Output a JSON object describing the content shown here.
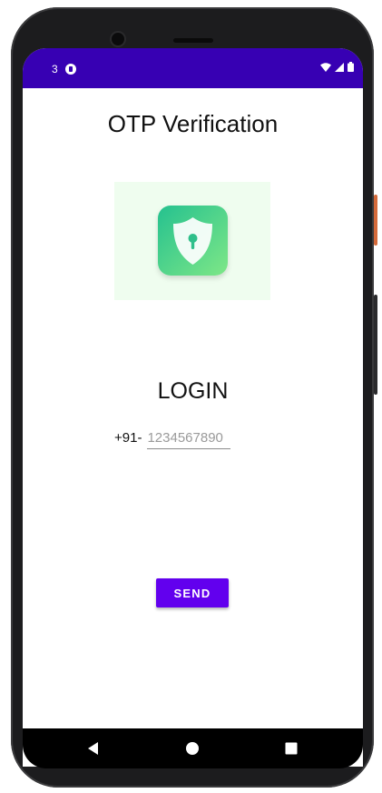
{
  "status_bar": {
    "notification_count": "3",
    "background": "#3700b3"
  },
  "screen": {
    "title": "OTP Verification",
    "login_label": "LOGIN",
    "phone": {
      "country_code": "+91-",
      "placeholder": "1234567890"
    },
    "send_label": "SEND"
  },
  "colors": {
    "accent": "#6200ee",
    "logo_gradient_start": "#25c18f",
    "logo_gradient_end": "#7ee787",
    "logo_background": "#effdef"
  },
  "icons": {
    "logo": "shield-lock-icon",
    "nav_back": "back-triangle-icon",
    "nav_home": "home-circle-icon",
    "nav_recents": "recents-square-icon"
  }
}
